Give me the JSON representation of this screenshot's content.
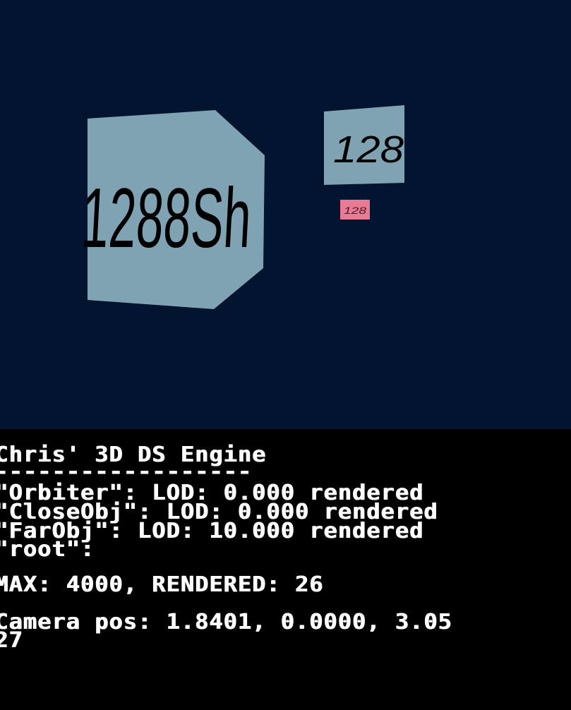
{
  "scene": {
    "background_color": "#021430",
    "close_obj": {
      "label": "1288Sh",
      "face_color": "#7fa3b3",
      "text_color": "#000000"
    },
    "far_obj": {
      "label": "128",
      "face_color": "#7fa3b3",
      "text_color": "#000000"
    },
    "orbiter": {
      "label": "128",
      "face_color": "#e87a94"
    }
  },
  "console": {
    "title": "Chris' 3D DS Engine",
    "separator": "------------------",
    "lines": [
      "\"Orbiter\": LOD: 0.000 rendered",
      "\"CloseObj\": LOD: 0.000 rendered",
      "\"FarObj\": LOD: 10.000 rendered",
      "\"root\":"
    ],
    "stats": "MAX: 4000, RENDERED: 26",
    "camera_line1": "Camera pos: 1.8401, 0.0000, 3.05",
    "camera_line2": "27"
  }
}
